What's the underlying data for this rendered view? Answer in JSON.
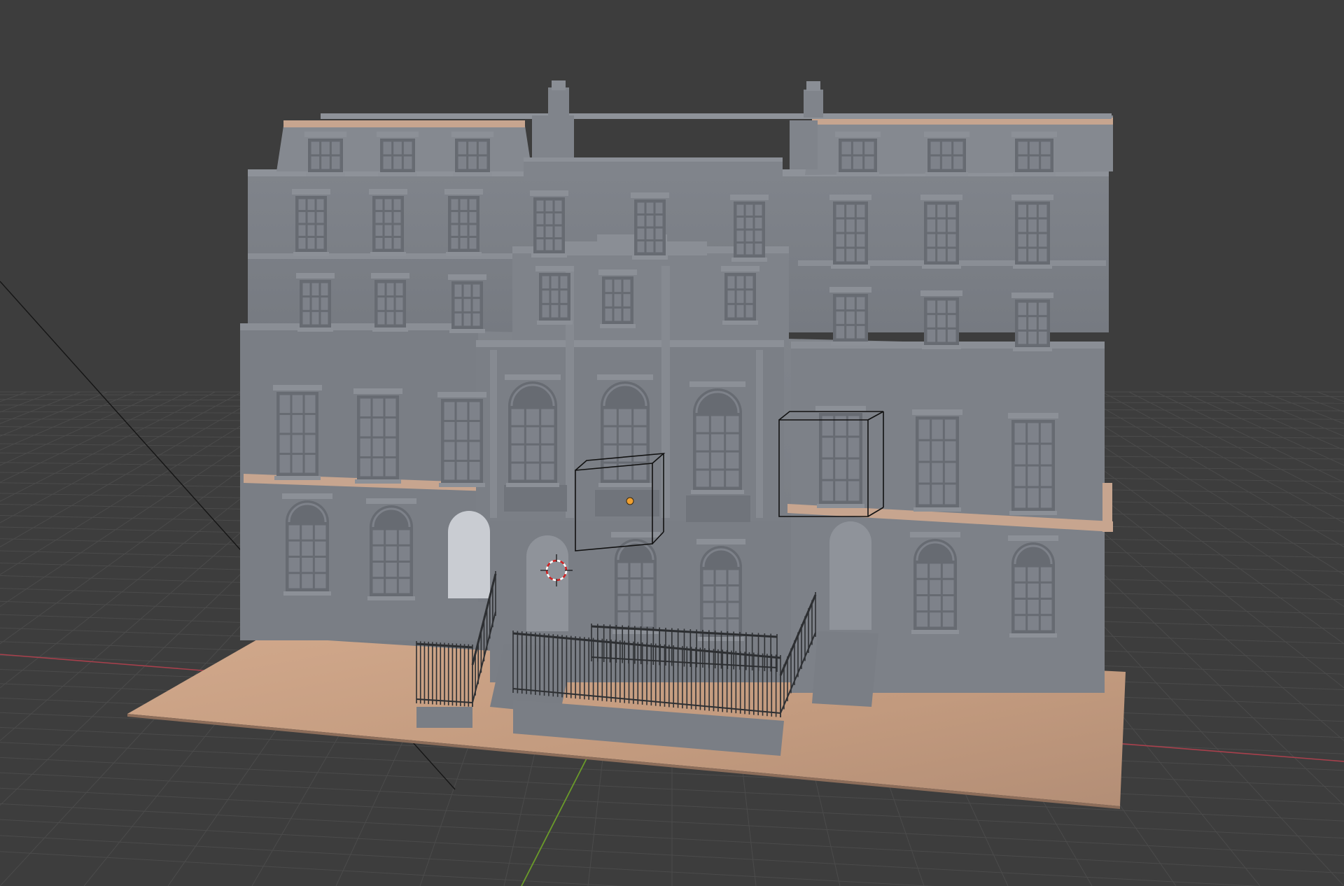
{
  "app": {
    "view": "3d-viewport",
    "shading": "solid"
  },
  "scene": {
    "object": "georgian-townhouse-terrace",
    "colors": {
      "background": "#3d3d3d",
      "grid": "#4a4a4a",
      "x_axis": "#a8404c",
      "y_axis": "#6a9a2a",
      "building": "#7b7f86",
      "building_shadow": "#6a6d73",
      "ground": "#c39a7e",
      "origin_point": "#f0a030"
    },
    "selected_objects": 2
  }
}
